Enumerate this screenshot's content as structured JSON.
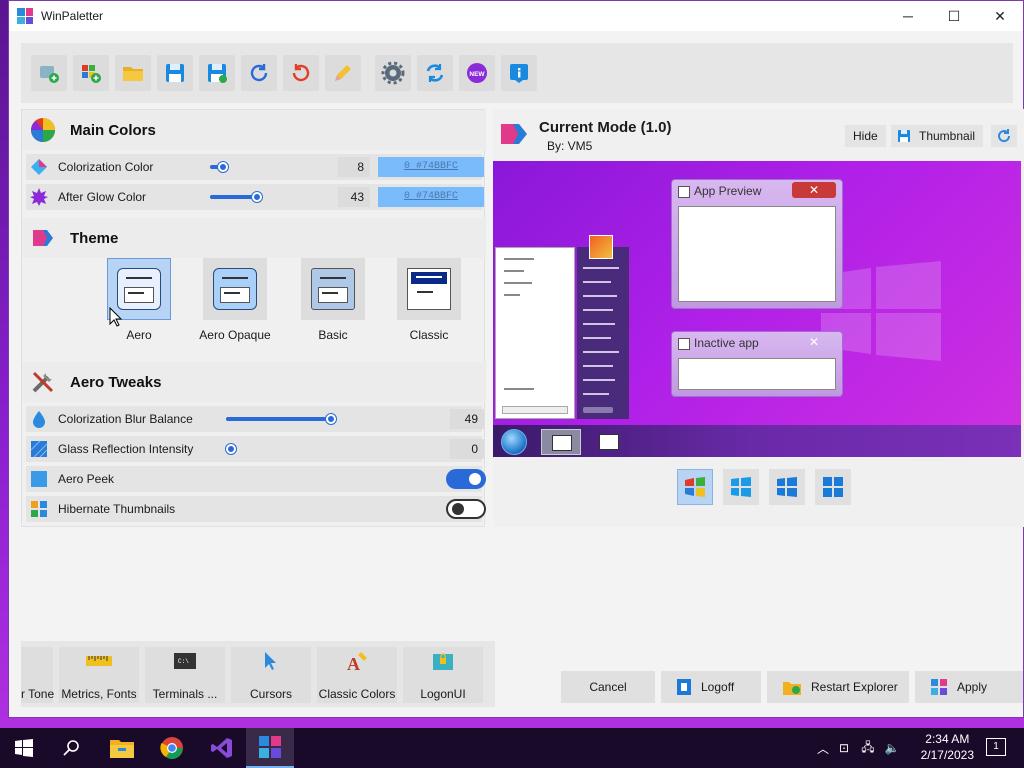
{
  "window": {
    "title": "WinPaletter"
  },
  "main_colors": {
    "title": "Main Colors",
    "colorization": {
      "label": "Colorization Color",
      "value": "8",
      "color_text": "0 #74BBFC"
    },
    "after_glow": {
      "label": "After Glow Color",
      "value": "43",
      "color_text": "0 #74BBFC"
    }
  },
  "theme": {
    "title": "Theme",
    "items": [
      {
        "label": "Aero",
        "selected": true
      },
      {
        "label": "Aero Opaque",
        "selected": false
      },
      {
        "label": "Basic",
        "selected": false
      },
      {
        "label": "Classic",
        "selected": false
      }
    ]
  },
  "aero_tweaks": {
    "title": "Aero Tweaks",
    "blur_balance": {
      "label": "Colorization Blur Balance",
      "value": "49"
    },
    "glass_reflection": {
      "label": "Glass Reflection Intensity",
      "value": "0"
    },
    "aero_peek": {
      "label": "Aero Peek",
      "on": true
    },
    "hibernate": {
      "label": "Hibernate Thumbnails",
      "on": false
    }
  },
  "preview": {
    "title": "Current Mode (1.0)",
    "author": "By: VM5",
    "hide_label": "Hide",
    "thumbnail_label": "Thumbnail",
    "app_preview_label": "App Preview",
    "inactive_label": "Inactive app"
  },
  "bottom_tabs": [
    {
      "label": "r Tone"
    },
    {
      "label": "Metrics, Fonts"
    },
    {
      "label": "Terminals ..."
    },
    {
      "label": "Cursors"
    },
    {
      "label": "Classic Colors"
    },
    {
      "label": "LogonUI"
    }
  ],
  "actions": {
    "cancel": "Cancel",
    "logoff": "Logoff",
    "restart_explorer": "Restart Explorer",
    "apply": "Apply"
  },
  "taskbar": {
    "time": "2:34 AM",
    "date": "2/17/2023",
    "notification_count": "1"
  },
  "colors": {
    "accent": "#2a6ad8",
    "preview_color": "#74BBFC"
  }
}
